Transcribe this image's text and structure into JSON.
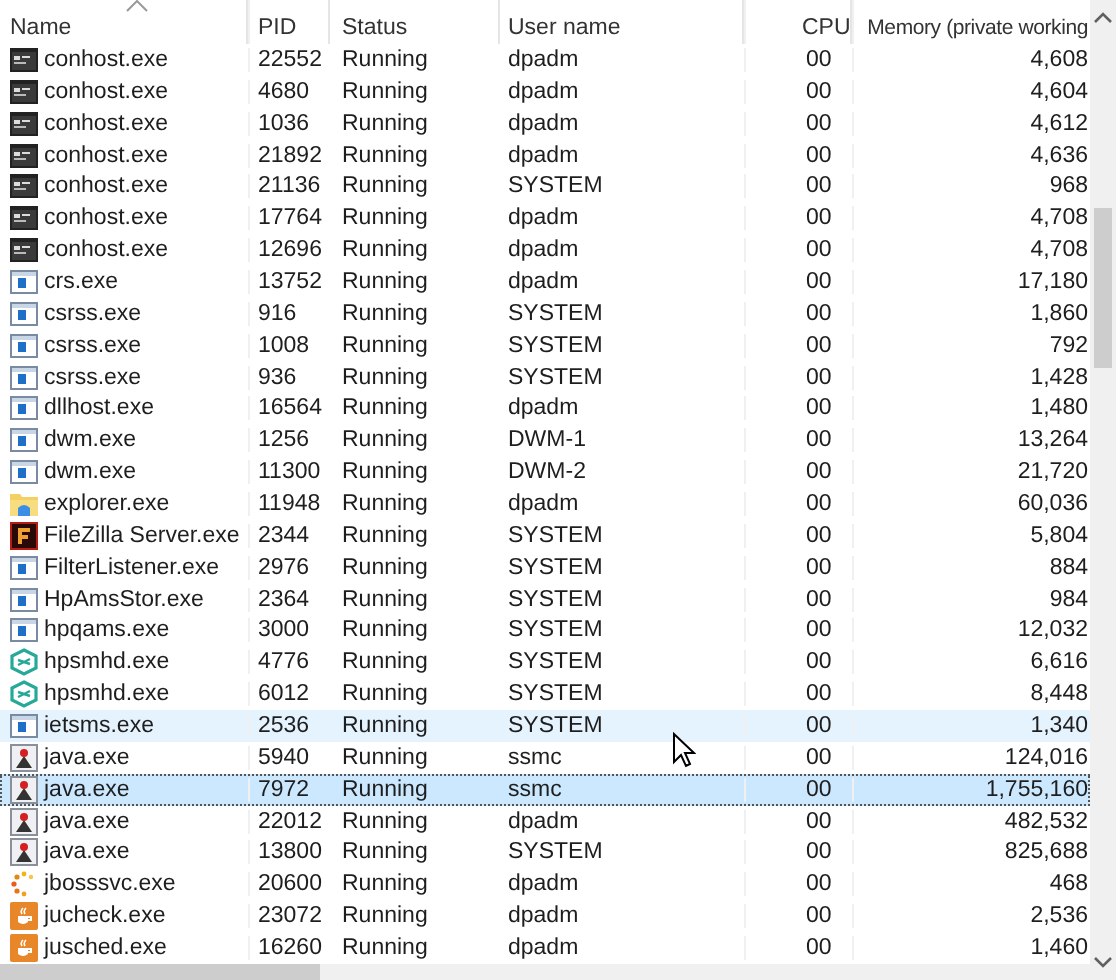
{
  "table": {
    "columns": [
      {
        "label": "Name",
        "sorted": true
      },
      {
        "label": "PID",
        "sorted": false
      },
      {
        "label": "Status",
        "sorted": false
      },
      {
        "label": "User name",
        "sorted": false
      },
      {
        "label": "CPU",
        "sorted": false
      },
      {
        "label": "Memory (private working",
        "sorted": false
      }
    ],
    "rows": [
      {
        "kind": "console",
        "name": "conhost.exe",
        "pid": "22552",
        "status": "Running",
        "user": "dpadm",
        "cpu": "00",
        "memory": "4,608",
        "selected": false,
        "hovered": false
      },
      {
        "kind": "console",
        "name": "conhost.exe",
        "pid": "4680",
        "status": "Running",
        "user": "dpadm",
        "cpu": "00",
        "memory": "4,604",
        "selected": false,
        "hovered": false
      },
      {
        "kind": "console",
        "name": "conhost.exe",
        "pid": "1036",
        "status": "Running",
        "user": "dpadm",
        "cpu": "00",
        "memory": "4,612",
        "selected": false,
        "hovered": false
      },
      {
        "kind": "console",
        "name": "conhost.exe",
        "pid": "21892",
        "status": "Running",
        "user": "dpadm",
        "cpu": "00",
        "memory": "4,636",
        "selected": false,
        "hovered": false
      },
      {
        "kind": "console",
        "name": "conhost.exe",
        "pid": "21136",
        "status": "Running",
        "user": "SYSTEM",
        "cpu": "00",
        "memory": "968",
        "selected": false,
        "hovered": false
      },
      {
        "kind": "console",
        "name": "conhost.exe",
        "pid": "17764",
        "status": "Running",
        "user": "dpadm",
        "cpu": "00",
        "memory": "4,708",
        "selected": false,
        "hovered": false
      },
      {
        "kind": "console",
        "name": "conhost.exe",
        "pid": "12696",
        "status": "Running",
        "user": "dpadm",
        "cpu": "00",
        "memory": "4,708",
        "selected": false,
        "hovered": false
      },
      {
        "kind": "app",
        "name": "crs.exe",
        "pid": "13752",
        "status": "Running",
        "user": "dpadm",
        "cpu": "00",
        "memory": "17,180",
        "selected": false,
        "hovered": false
      },
      {
        "kind": "app",
        "name": "csrss.exe",
        "pid": "916",
        "status": "Running",
        "user": "SYSTEM",
        "cpu": "00",
        "memory": "1,860",
        "selected": false,
        "hovered": false
      },
      {
        "kind": "app",
        "name": "csrss.exe",
        "pid": "1008",
        "status": "Running",
        "user": "SYSTEM",
        "cpu": "00",
        "memory": "792",
        "selected": false,
        "hovered": false
      },
      {
        "kind": "app",
        "name": "csrss.exe",
        "pid": "936",
        "status": "Running",
        "user": "SYSTEM",
        "cpu": "00",
        "memory": "1,428",
        "selected": false,
        "hovered": false
      },
      {
        "kind": "app",
        "name": "dllhost.exe",
        "pid": "16564",
        "status": "Running",
        "user": "dpadm",
        "cpu": "00",
        "memory": "1,480",
        "selected": false,
        "hovered": false
      },
      {
        "kind": "app",
        "name": "dwm.exe",
        "pid": "1256",
        "status": "Running",
        "user": "DWM-1",
        "cpu": "00",
        "memory": "13,264",
        "selected": false,
        "hovered": false
      },
      {
        "kind": "app",
        "name": "dwm.exe",
        "pid": "11300",
        "status": "Running",
        "user": "DWM-2",
        "cpu": "00",
        "memory": "21,720",
        "selected": false,
        "hovered": false
      },
      {
        "kind": "folder",
        "name": "explorer.exe",
        "pid": "11948",
        "status": "Running",
        "user": "dpadm",
        "cpu": "00",
        "memory": "60,036",
        "selected": false,
        "hovered": false
      },
      {
        "kind": "ftp",
        "name": "FileZilla Server.exe",
        "pid": "2344",
        "status": "Running",
        "user": "SYSTEM",
        "cpu": "00",
        "memory": "5,804",
        "selected": false,
        "hovered": false
      },
      {
        "kind": "app",
        "name": "FilterListener.exe",
        "pid": "2976",
        "status": "Running",
        "user": "SYSTEM",
        "cpu": "00",
        "memory": "884",
        "selected": false,
        "hovered": false
      },
      {
        "kind": "app",
        "name": "HpAmsStor.exe",
        "pid": "2364",
        "status": "Running",
        "user": "SYSTEM",
        "cpu": "00",
        "memory": "984",
        "selected": false,
        "hovered": false
      },
      {
        "kind": "app",
        "name": "hpqams.exe",
        "pid": "3000",
        "status": "Running",
        "user": "SYSTEM",
        "cpu": "00",
        "memory": "12,032",
        "selected": false,
        "hovered": false
      },
      {
        "kind": "hex",
        "name": "hpsmhd.exe",
        "pid": "4776",
        "status": "Running",
        "user": "SYSTEM",
        "cpu": "00",
        "memory": "6,616",
        "selected": false,
        "hovered": false
      },
      {
        "kind": "hex",
        "name": "hpsmhd.exe",
        "pid": "6012",
        "status": "Running",
        "user": "SYSTEM",
        "cpu": "00",
        "memory": "8,448",
        "selected": false,
        "hovered": false
      },
      {
        "kind": "app",
        "name": "ietsms.exe",
        "pid": "2536",
        "status": "Running",
        "user": "SYSTEM",
        "cpu": "00",
        "memory": "1,340",
        "selected": false,
        "hovered": true
      },
      {
        "kind": "java",
        "name": "java.exe",
        "pid": "5940",
        "status": "Running",
        "user": "ssmc",
        "cpu": "00",
        "memory": "124,016",
        "selected": false,
        "hovered": false
      },
      {
        "kind": "java",
        "name": "java.exe",
        "pid": "7972",
        "status": "Running",
        "user": "ssmc",
        "cpu": "00",
        "memory": "1,755,160",
        "selected": true,
        "hovered": false
      },
      {
        "kind": "java",
        "name": "java.exe",
        "pid": "22012",
        "status": "Running",
        "user": "dpadm",
        "cpu": "00",
        "memory": "482,532",
        "selected": false,
        "hovered": false
      },
      {
        "kind": "java",
        "name": "java.exe",
        "pid": "13800",
        "status": "Running",
        "user": "SYSTEM",
        "cpu": "00",
        "memory": "825,688",
        "selected": false,
        "hovered": false
      },
      {
        "kind": "spinner",
        "name": "jbosssvc.exe",
        "pid": "20600",
        "status": "Running",
        "user": "dpadm",
        "cpu": "00",
        "memory": "468",
        "selected": false,
        "hovered": false
      },
      {
        "kind": "cup",
        "name": "jucheck.exe",
        "pid": "23072",
        "status": "Running",
        "user": "dpadm",
        "cpu": "00",
        "memory": "2,536",
        "selected": false,
        "hovered": false
      },
      {
        "kind": "cup",
        "name": "jusched.exe",
        "pid": "16260",
        "status": "Running",
        "user": "dpadm",
        "cpu": "00",
        "memory": "1,460",
        "selected": false,
        "hovered": false
      }
    ]
  }
}
